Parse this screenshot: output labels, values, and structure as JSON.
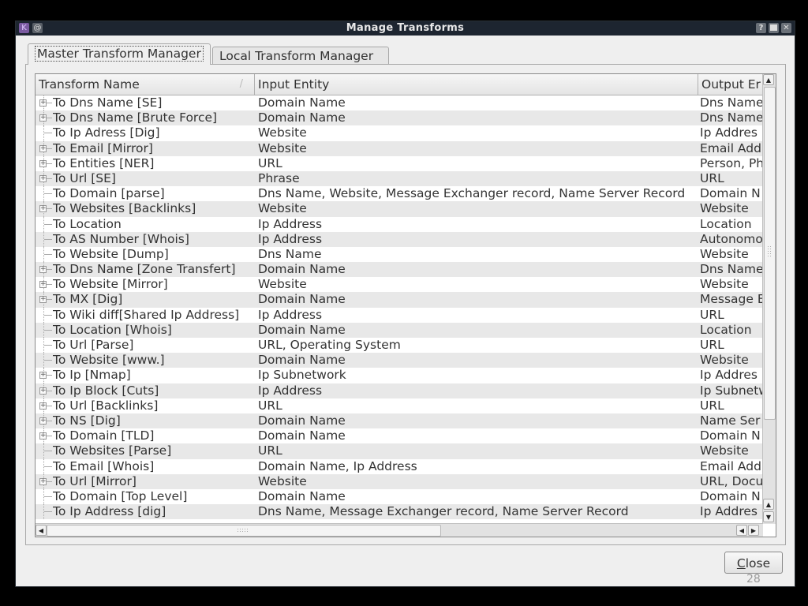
{
  "window": {
    "title": "Manage Transforms",
    "icons": [
      "app-icon",
      "window-menu-icon",
      "help-icon",
      "maximize-icon",
      "close-icon"
    ]
  },
  "tabs": [
    {
      "label": "Master Transform Manager",
      "active": true
    },
    {
      "label": "Local Transform Manager",
      "active": false
    }
  ],
  "table": {
    "columns": [
      "Transform Name",
      "Input Entity",
      "Output Er"
    ],
    "rows": [
      {
        "name": "To Dns Name [SE]",
        "input": "Domain Name",
        "output": "Dns Name",
        "expandable": true
      },
      {
        "name": "To Dns Name [Brute Force]",
        "input": "Domain Name",
        "output": "Dns Name",
        "expandable": true
      },
      {
        "name": "To Ip Adress [Dig]",
        "input": "Website",
        "output": "Ip Addres",
        "expandable": false
      },
      {
        "name": "To Email [Mirror]",
        "input": "Website",
        "output": "Email Add",
        "expandable": true
      },
      {
        "name": "To Entities [NER]",
        "input": "URL",
        "output": "Person, Ph",
        "expandable": true
      },
      {
        "name": "To Url [SE]",
        "input": "Phrase",
        "output": "URL",
        "expandable": true
      },
      {
        "name": "To Domain [parse]",
        "input": "Dns Name, Website, Message Exchanger record, Name Server Record",
        "output": "Domain N",
        "expandable": false
      },
      {
        "name": "To Websites [Backlinks]",
        "input": "Website",
        "output": "Website",
        "expandable": true
      },
      {
        "name": "To Location",
        "input": "Ip Address",
        "output": "Location",
        "expandable": false
      },
      {
        "name": "To AS Number [Whois]",
        "input": "Ip Address",
        "output": "Autonomo",
        "expandable": false
      },
      {
        "name": "To Website [Dump]",
        "input": "Dns Name",
        "output": "Website",
        "expandable": false
      },
      {
        "name": "To Dns Name [Zone Transfert]",
        "input": "Domain Name",
        "output": "Dns Name",
        "expandable": true
      },
      {
        "name": "To Website [Mirror]",
        "input": "Website",
        "output": "Website",
        "expandable": true
      },
      {
        "name": "To MX [Dig]",
        "input": "Domain Name",
        "output": "Message E",
        "expandable": true
      },
      {
        "name": "To Wiki diff[Shared Ip Address]",
        "input": "Ip Address",
        "output": "URL",
        "expandable": false
      },
      {
        "name": "To Location [Whois]",
        "input": "Domain Name",
        "output": "Location",
        "expandable": false
      },
      {
        "name": "To Url [Parse]",
        "input": "URL, Operating System",
        "output": "URL",
        "expandable": false
      },
      {
        "name": "To Website [www.]",
        "input": "Domain Name",
        "output": "Website",
        "expandable": false
      },
      {
        "name": "To Ip [Nmap]",
        "input": "Ip Subnetwork",
        "output": "Ip Addres",
        "expandable": true
      },
      {
        "name": "To Ip Block [Cuts]",
        "input": "Ip Address",
        "output": "Ip Subnetw",
        "expandable": true
      },
      {
        "name": "To Url [Backlinks]",
        "input": "URL",
        "output": "URL",
        "expandable": true
      },
      {
        "name": "To NS [Dig]",
        "input": "Domain Name",
        "output": "Name Ser",
        "expandable": true
      },
      {
        "name": "To Domain [TLD]",
        "input": "Domain Name",
        "output": "Domain N",
        "expandable": true
      },
      {
        "name": "To Websites [Parse]",
        "input": "URL",
        "output": "Website",
        "expandable": false
      },
      {
        "name": "To Email [Whois]",
        "input": "Domain Name, Ip Address",
        "output": "Email Add",
        "expandable": false
      },
      {
        "name": "To Url [Mirror]",
        "input": "Website",
        "output": "URL, Docu",
        "expandable": true
      },
      {
        "name": "To Domain [Top Level]",
        "input": "Domain Name",
        "output": "Domain N",
        "expandable": false
      },
      {
        "name": "To Ip Address [dig]",
        "input": "Dns Name, Message Exchanger record, Name Server Record",
        "output": "Ip Addres",
        "expandable": false
      }
    ]
  },
  "buttons": {
    "close_prefix": "C",
    "close_rest": "lose"
  },
  "page_number": "28"
}
